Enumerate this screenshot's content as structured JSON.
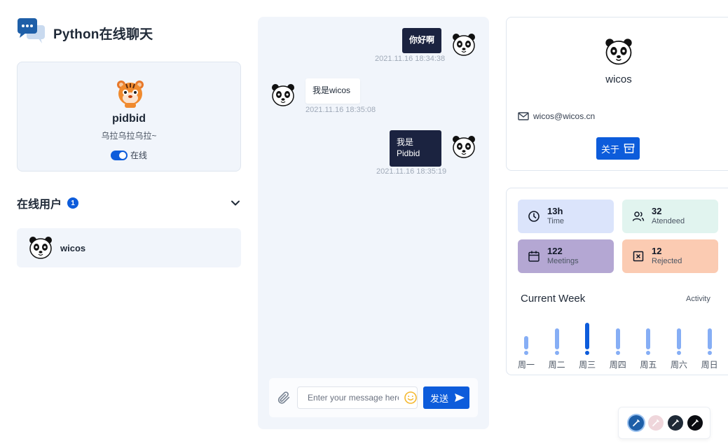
{
  "app": {
    "title": "Python在线聊天"
  },
  "profile": {
    "name": "pidbid",
    "motto": "乌拉乌拉乌拉~",
    "status": "在线"
  },
  "online": {
    "title": "在线用户",
    "count": "1",
    "users": [
      {
        "name": "wicos"
      }
    ]
  },
  "chat": {
    "messages": [
      {
        "text": "你好啊",
        "time": "2021.11.16 18:34:38",
        "side": "right"
      },
      {
        "text": "我是wicos",
        "time": "2021.11.16 18:35:08",
        "side": "left"
      },
      {
        "text_line1": "我是",
        "text_line2": "Pidbid",
        "time": "2021.11.16 18:35:19",
        "side": "right"
      }
    ],
    "input_placeholder": "Enter your message here",
    "send_label": "发送"
  },
  "contact": {
    "name": "wicos",
    "email": "wicos@wicos.cn",
    "about_label": "关于"
  },
  "stats": [
    {
      "value": "13h",
      "label": "Time",
      "color": "#dbe4fb",
      "icon": "clock-icon"
    },
    {
      "value": "32",
      "label": "Atendeed",
      "color": "#e1f4ef",
      "icon": "users-icon"
    },
    {
      "value": "122",
      "label": "Meetings",
      "color": "#b4a7d3",
      "icon": "calendar-icon"
    },
    {
      "value": "12",
      "label": "Rejected",
      "color": "#fbcbb2",
      "icon": "x-square-icon"
    }
  ],
  "week": {
    "title": "Current Week",
    "activity_label": "Activity",
    "days": [
      {
        "label": "周一",
        "level": 0.5,
        "active": false
      },
      {
        "label": "周二",
        "level": 0.8,
        "active": false
      },
      {
        "label": "周三",
        "level": 1.0,
        "active": true
      },
      {
        "label": "周四",
        "level": 0.8,
        "active": false
      },
      {
        "label": "周五",
        "level": 0.8,
        "active": false
      },
      {
        "label": "周六",
        "level": 0.8,
        "active": false
      },
      {
        "label": "周日",
        "level": 0.8,
        "active": false
      }
    ]
  },
  "theme": {
    "colors": [
      "#1e5fa8",
      "#efd6db",
      "#1f2a37",
      "#0b0d12"
    ]
  }
}
